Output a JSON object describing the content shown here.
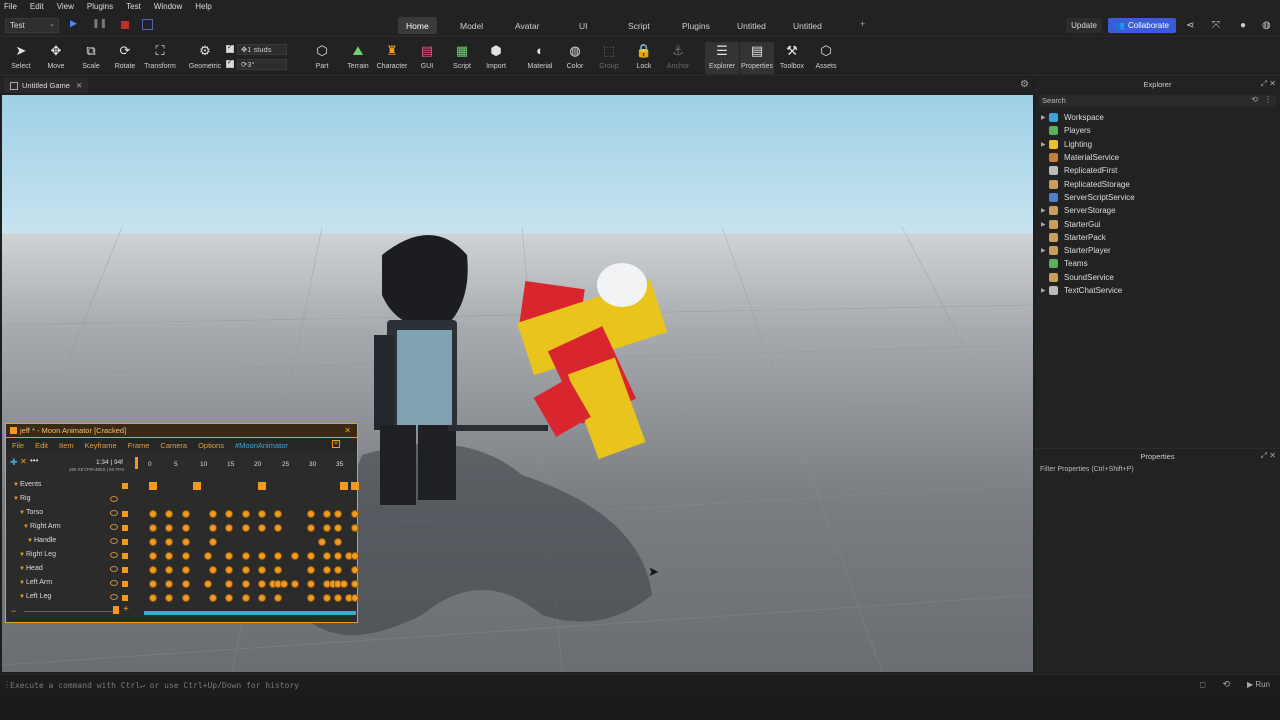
{
  "menubar": [
    "File",
    "Edit",
    "View",
    "Plugins",
    "Test",
    "Window",
    "Help"
  ],
  "mode_select": "Test",
  "tabs": [
    "Home",
    "Model",
    "Avatar",
    "UI",
    "Script",
    "Plugins",
    "Untitled",
    "Untitled"
  ],
  "active_tab": "Home",
  "add_tab": "+",
  "update_label": "Update",
  "collaborate_label": "Collaborate",
  "tools": {
    "select": "Select",
    "move": "Move",
    "scale": "Scale",
    "rotate": "Rotate",
    "transform": "Transform",
    "geometric": "Geometric",
    "part": "Part",
    "terrain": "Terrain",
    "character": "Character",
    "gui": "GUI",
    "script": "Script",
    "import": "Import",
    "material": "Material",
    "color": "Color",
    "group": "Group",
    "lock": "Lock",
    "anchor": "Anchor",
    "explorer": "Explorer",
    "properties": "Properties",
    "toolbox": "Toolbox",
    "assets": "Assets"
  },
  "snap": {
    "move_value": "1 studs",
    "rotate_value": "3°"
  },
  "doc_tab": "Untitled Game",
  "doc_tab_close": "✕",
  "command_bar": {
    "placeholder": "Execute a command with Ctrl↵ or use Ctrl+Up/Down for history",
    "run_label": "Run"
  },
  "explorer": {
    "title": "Explorer",
    "search_placeholder": "Search",
    "items": [
      {
        "label": "Workspace",
        "expand": "▶",
        "color": "#3aa3d9"
      },
      {
        "label": "Players",
        "expand": "",
        "color": "#5bb05b"
      },
      {
        "label": "Lighting",
        "expand": "▶",
        "color": "#f0c02a"
      },
      {
        "label": "MaterialService",
        "expand": "",
        "color": "#c47e3a"
      },
      {
        "label": "ReplicatedFirst",
        "expand": "",
        "color": "#bbbbbb"
      },
      {
        "label": "ReplicatedStorage",
        "expand": "",
        "color": "#c79e5a"
      },
      {
        "label": "ServerScriptService",
        "expand": "",
        "color": "#4e7fc8"
      },
      {
        "label": "ServerStorage",
        "expand": "▶",
        "color": "#c79e5a"
      },
      {
        "label": "StarterGui",
        "expand": "▶",
        "color": "#c79e5a"
      },
      {
        "label": "StarterPack",
        "expand": "",
        "color": "#c79e5a"
      },
      {
        "label": "StarterPlayer",
        "expand": "▶",
        "color": "#c79e5a"
      },
      {
        "label": "Teams",
        "expand": "",
        "color": "#5bb05b"
      },
      {
        "label": "SoundService",
        "expand": "",
        "color": "#c79e5a"
      },
      {
        "label": "TextChatService",
        "expand": "▶",
        "color": "#bbbbbb"
      }
    ]
  },
  "properties": {
    "title": "Properties",
    "filter_placeholder": "Filter Properties (Ctrl+Shift+P)"
  },
  "moon": {
    "title": "jeff * - Moon Animator [Cracked]",
    "menu": [
      "File",
      "Edit",
      "Item",
      "Keyframe",
      "Frame",
      "Camera",
      "Options"
    ],
    "tagline": "#MoonAnimator",
    "time": "1:34 | 94f",
    "fps": "280 KEYFRAMES | 60 FPS",
    "ticks": [
      "0",
      "5",
      "10",
      "15",
      "20",
      "25",
      "30",
      "35"
    ],
    "tracks": [
      "Events",
      "Rig",
      "Torso",
      "Right Arm",
      "Handle",
      "Right Leg",
      "Head",
      "Left Arm",
      "Left Leg"
    ],
    "minus": "−",
    "plus": "+"
  }
}
